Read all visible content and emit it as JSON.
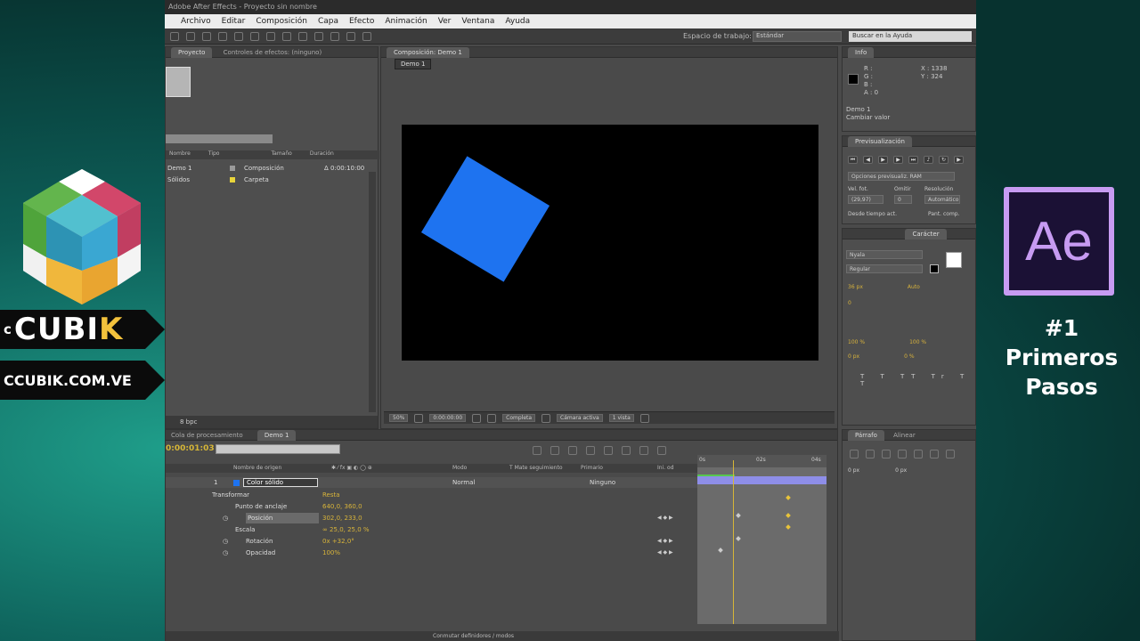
{
  "brand": {
    "name_c": "c",
    "name_cu": "CUBI",
    "name_k": "K",
    "url": "CCUBIK.COM.VE"
  },
  "ae_logo": "Ae",
  "episode": {
    "line1": "#1",
    "line2": "Primeros",
    "line3": "Pasos"
  },
  "app": {
    "title": "Adobe After Effects - Proyecto sin nombre",
    "menu": [
      "Archivo",
      "Editar",
      "Composición",
      "Capa",
      "Efecto",
      "Animación",
      "Ver",
      "Ventana",
      "Ayuda"
    ],
    "workspace_label": "Espacio de trabajo:",
    "workspace_value": "Estándar",
    "help_search": "Buscar en la Ayuda"
  },
  "project": {
    "tab": "Proyecto",
    "tab2": "Controles de efectos: (ninguno)",
    "columns": [
      "Nombre",
      "Tipo",
      "Tamaño",
      "Duración"
    ],
    "items": [
      {
        "name": "Demo 1",
        "type": "Composición",
        "duration": "Δ 0:00:10:00",
        "color": "#9a9a9a"
      },
      {
        "name": "Sólidos",
        "type": "Carpeta",
        "duration": "",
        "color": "#e8d43a"
      }
    ],
    "bpc": "8 bpc"
  },
  "viewer": {
    "tab": "Composición: Demo 1",
    "comp_tab": "Demo 1",
    "zoom": "50%",
    "timecode": "0:00:00:00",
    "resolution": "Completa",
    "camera": "Cámara activa",
    "views": "1 vista"
  },
  "info": {
    "tab": "Info",
    "r": "R :",
    "g": "G :",
    "b": "B :",
    "a": "A : 0",
    "x": "X : 1338",
    "y": "Y : 324",
    "foot1": "Demo 1",
    "foot2": "Cambiar valor"
  },
  "preview": {
    "tab": "Previsualización",
    "ram_label": "Opciones previsualiz. RAM",
    "fps_label": "Vel. fot.",
    "skip_label": "Omitir",
    "res_label": "Resolución",
    "fps_value": "(29,97)",
    "skip_value": "0",
    "res_value": "Automático",
    "from_label": "Desde tiempo act.",
    "full_label": "Pant. comp."
  },
  "character": {
    "tab": "Carácter",
    "tab2": "Párrafo",
    "font": "Nyala",
    "style": "Regular",
    "size": "36 px",
    "leading": "Auto",
    "tracking": "0",
    "scale_v": "100 %",
    "scale_h": "100 %",
    "baseline": "0 px",
    "tsume": "0 %"
  },
  "paragraph": {
    "tab": "Párrafo",
    "tab2": "Alinear",
    "indent1": "0 px",
    "indent2": "0 px"
  },
  "timeline": {
    "tab1": "Cola de procesamiento",
    "tab2": "Demo 1",
    "current_time": "0:00:01:03",
    "columns": {
      "layer": "Nombre de origen",
      "switches": "✱ ⁄ fx ▣ ◐ ◯ ⊕",
      "mode": "Modo",
      "trkmat": "T  Mate seguimiento",
      "parent": "Primario",
      "in": "Ini. od"
    },
    "ruler": [
      "0s",
      "02s",
      "04s"
    ],
    "layer": {
      "index": "1",
      "name": "Color sólido",
      "mode": "Normal",
      "parent": "Ninguno"
    },
    "props": [
      {
        "name": "Transformar",
        "value": "Resta"
      },
      {
        "name": "Punto de anclaje",
        "value": "640,0, 360,0"
      },
      {
        "name": "Posición",
        "value": "302,0, 233,0"
      },
      {
        "name": "Escala",
        "value": "∞ 25,0, 25,0 %"
      },
      {
        "name": "Rotación",
        "value": "0x +32,0°"
      },
      {
        "name": "Opacidad",
        "value": "100%"
      }
    ],
    "toggle": "Conmutar definidores / modos"
  }
}
